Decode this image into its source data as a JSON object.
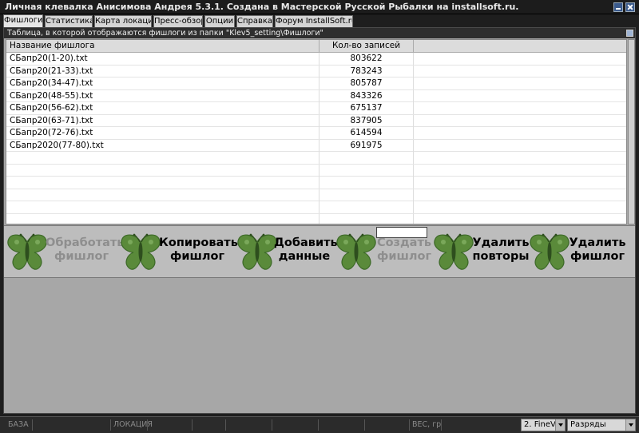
{
  "window": {
    "title": "Личная клевалка Анисимова Андрея 5.3.1. Создана в Мастерской Русской Рыбалки на installsoft.ru."
  },
  "tabs": [
    {
      "label": "Фишлоги",
      "active": true
    },
    {
      "label": "Статистика",
      "active": false
    },
    {
      "label": "Карта локаций",
      "active": false
    },
    {
      "label": "Пресс-обзор",
      "active": false
    },
    {
      "label": "Опции",
      "active": false
    },
    {
      "label": "Справка",
      "active": false
    },
    {
      "label": "Форум InstallSoft.ru",
      "active": false
    }
  ],
  "panel": {
    "caption": "Таблица, в которой отображаются фишлоги из папки \"Klev5_setting\\Фишлоги\""
  },
  "table": {
    "columns": [
      "Название фишлога",
      "Кол-во записей"
    ],
    "rows": [
      {
        "name": "СБапр20(1-20).txt",
        "count": "803622"
      },
      {
        "name": "СБапр20(21-33).txt",
        "count": "783243"
      },
      {
        "name": "СБапр20(34-47).txt",
        "count": "805787"
      },
      {
        "name": "СБапр20(48-55).txt",
        "count": "843326"
      },
      {
        "name": "СБапр20(56-62).txt",
        "count": "675137"
      },
      {
        "name": "СБапр20(63-71).txt",
        "count": "837905"
      },
      {
        "name": "СБапр20(72-76).txt",
        "count": "614594"
      },
      {
        "name": "СБапр2020(77-80).txt",
        "count": "691975"
      }
    ]
  },
  "actions": [
    {
      "label": "Обработать\nфишлог",
      "enabled": false,
      "icon": "butterfly-icon"
    },
    {
      "label": "Копировать\nфишлог",
      "enabled": true,
      "icon": "butterfly-icon"
    },
    {
      "label": "Добавить\nданные",
      "enabled": true,
      "icon": "butterfly-icon"
    },
    {
      "label": "Создать\nфишлог",
      "enabled": false,
      "icon": "butterfly-icon"
    },
    {
      "label": "Удалить\nповторы",
      "enabled": true,
      "icon": "butterfly-icon"
    },
    {
      "label": "Удалить\nфишлог",
      "enabled": true,
      "icon": "butterfly-icon"
    }
  ],
  "status": {
    "base": "БАЗА",
    "location": "ЛОКАЦИЯ",
    "weight": "ВЕС, гр",
    "fine_select": "2. FineVe",
    "digits_select": "Разряды"
  },
  "colors": {
    "butterfly": "#5a8a3a",
    "butterfly_dark": "#3d6a28",
    "background": "#a7a7a7"
  }
}
